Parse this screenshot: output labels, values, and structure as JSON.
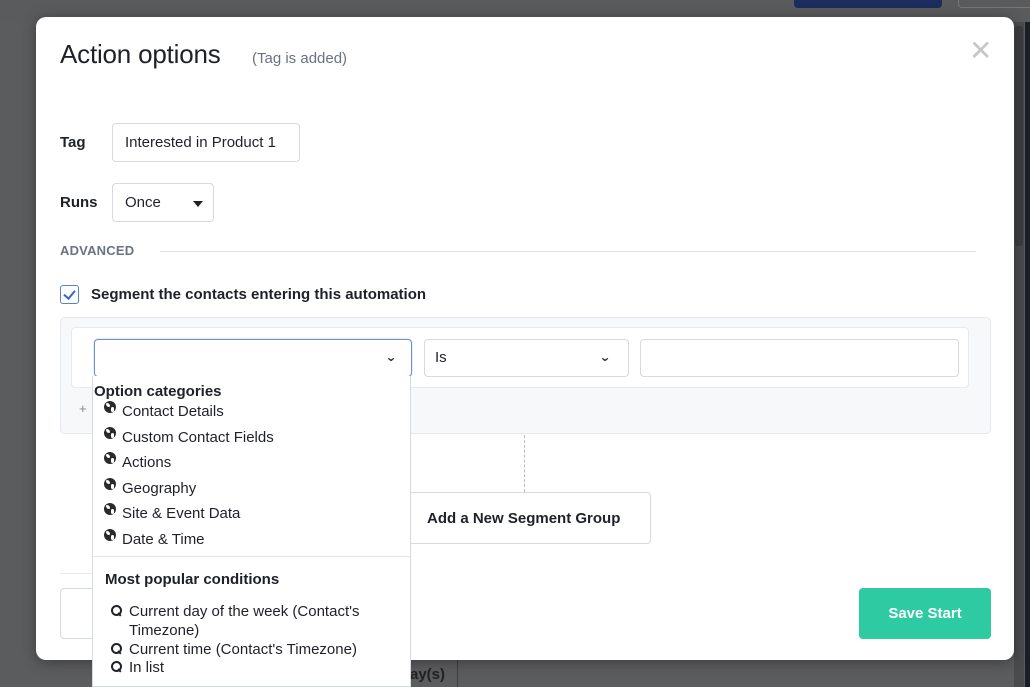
{
  "background": {
    "partial_tab_label": "ay(s)"
  },
  "modal": {
    "title": "Action options",
    "subtitle": "(Tag is added)",
    "close_glyph": "✕",
    "tag": {
      "label": "Tag",
      "value": "Interested in Product 1"
    },
    "runs": {
      "label": "Runs",
      "selected": "Once"
    },
    "advanced_label": "ADVANCED",
    "segment_checkbox": {
      "label": "Segment the contacts entering this automation",
      "checked": true
    },
    "segment": {
      "field_value": "",
      "operator_selected": "Is",
      "value": "",
      "add_condition_glyph": "+"
    },
    "add_group_button": "Add a New Segment Group",
    "save_button": "Save Start",
    "accent_color": "#2ecba3"
  },
  "dropdown": {
    "categories_heading": "Option categories",
    "categories": [
      {
        "label": "Contact Details",
        "icon": "globe-icon"
      },
      {
        "label": "Custom Contact Fields",
        "icon": "globe-icon"
      },
      {
        "label": "Actions",
        "icon": "globe-icon"
      },
      {
        "label": "Geography",
        "icon": "globe-icon"
      },
      {
        "label": "Site & Event Data",
        "icon": "globe-icon"
      },
      {
        "label": "Date & Time",
        "icon": "globe-icon"
      }
    ],
    "popular_heading": "Most popular conditions",
    "popular": [
      {
        "label": "Current day of the week (Contact's Timezone)",
        "icon": "search-icon"
      },
      {
        "label": "Current time (Contact's Timezone)",
        "icon": "search-icon"
      },
      {
        "label": "In list",
        "icon": "search-icon"
      }
    ]
  }
}
